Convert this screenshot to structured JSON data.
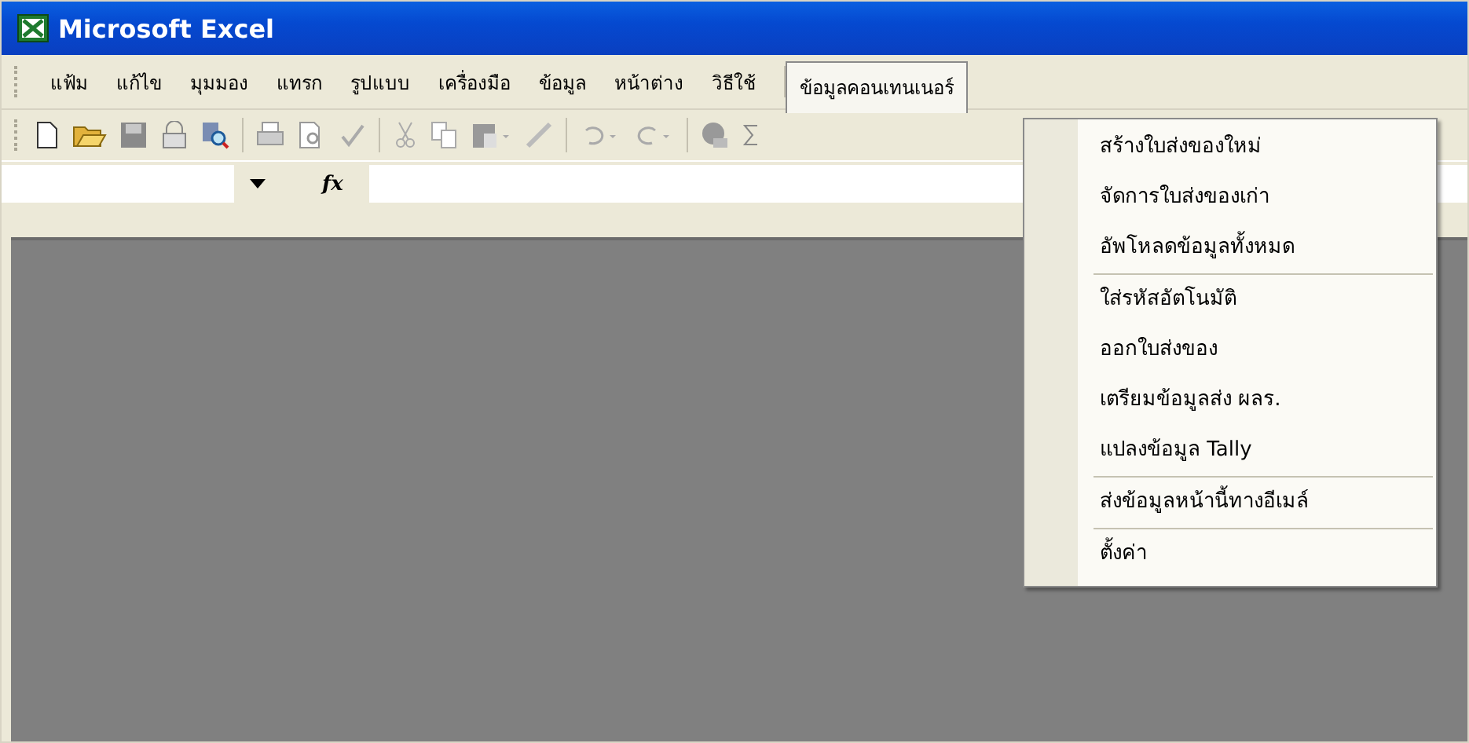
{
  "window": {
    "title": "Microsoft Excel"
  },
  "menu_bar": [
    {
      "label": "แฟ้ม",
      "selected": false
    },
    {
      "label": "แก้ไข",
      "selected": false
    },
    {
      "label": "มุมมอง",
      "selected": false
    },
    {
      "label": "แทรก",
      "selected": false
    },
    {
      "label": "รูปแบบ",
      "selected": false
    },
    {
      "label": "เครื่องมือ",
      "selected": false
    },
    {
      "label": "ข้อมูล",
      "selected": false
    },
    {
      "label": "หน้าต่าง",
      "selected": false
    },
    {
      "label": "วิธีใช้",
      "selected": false
    },
    {
      "label": "ข้อมูลคอนเทนเนอร์",
      "selected": true
    }
  ],
  "formula_bar": {
    "function_label": "fx"
  },
  "dropdown_menu": {
    "groups": [
      {
        "items": [
          "สร้างใบส่งของใหม่",
          "จัดการใบส่งของเก่า",
          "อัพโหลดข้อมูลทั้งหมด"
        ]
      },
      {
        "items": [
          "ใส่รหัสอัตโนมัติ",
          "ออกใบส่งของ",
          "เตรียมข้อมูลส่ง ผลร.",
          "แปลงข้อมูล Tally"
        ]
      },
      {
        "items": [
          "ส่งข้อมูลหน้านี้ทางอีเมล์"
        ]
      },
      {
        "items": [
          "ตั้งค่า"
        ]
      }
    ]
  }
}
